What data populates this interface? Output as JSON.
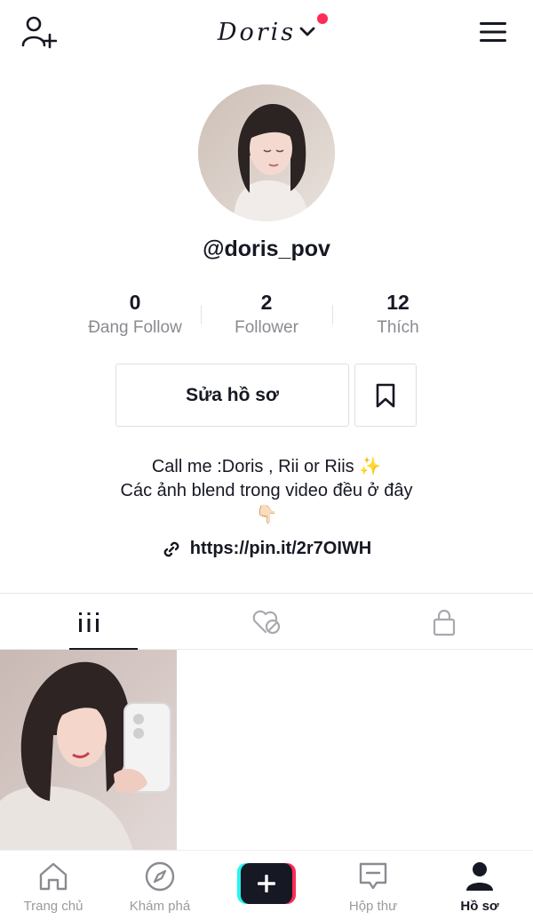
{
  "header": {
    "title": "Doris",
    "add_user_icon": "add-user-icon",
    "menu_icon": "hamburger-menu-icon",
    "notification_color": "#fe2c55"
  },
  "profile": {
    "username": "@doris_pov",
    "stats": [
      {
        "value": "0",
        "label": "Đang Follow"
      },
      {
        "value": "2",
        "label": "Follower"
      },
      {
        "value": "12",
        "label": "Thích"
      }
    ],
    "edit_button": "Sửa hồ sơ",
    "bio_line1": "Call me :Doris , Rii or Riis",
    "bio_sparkle": "✨",
    "bio_line2": "Các ảnh blend trong video đều ở đây",
    "bio_emoji": "👇🏻",
    "link": "https://pin.it/2r7OIWH"
  },
  "tabs": [
    {
      "name": "videos",
      "icon": "grid-icon",
      "active": true
    },
    {
      "name": "liked",
      "icon": "hidden-heart-icon",
      "active": false
    },
    {
      "name": "private",
      "icon": "lock-icon",
      "active": false
    }
  ],
  "bottom_nav": [
    {
      "label": "Trang chủ",
      "icon": "home-icon"
    },
    {
      "label": "Khám phá",
      "icon": "compass-icon"
    },
    {
      "label": "",
      "icon": "create-plus-icon"
    },
    {
      "label": "Hộp thư",
      "icon": "inbox-icon"
    },
    {
      "label": "Hồ sơ",
      "icon": "profile-icon",
      "active": true
    }
  ],
  "colors": {
    "text": "#161823",
    "muted": "#8a8b91",
    "accent_pink": "#fe2c55",
    "accent_cyan": "#25f4ee"
  }
}
